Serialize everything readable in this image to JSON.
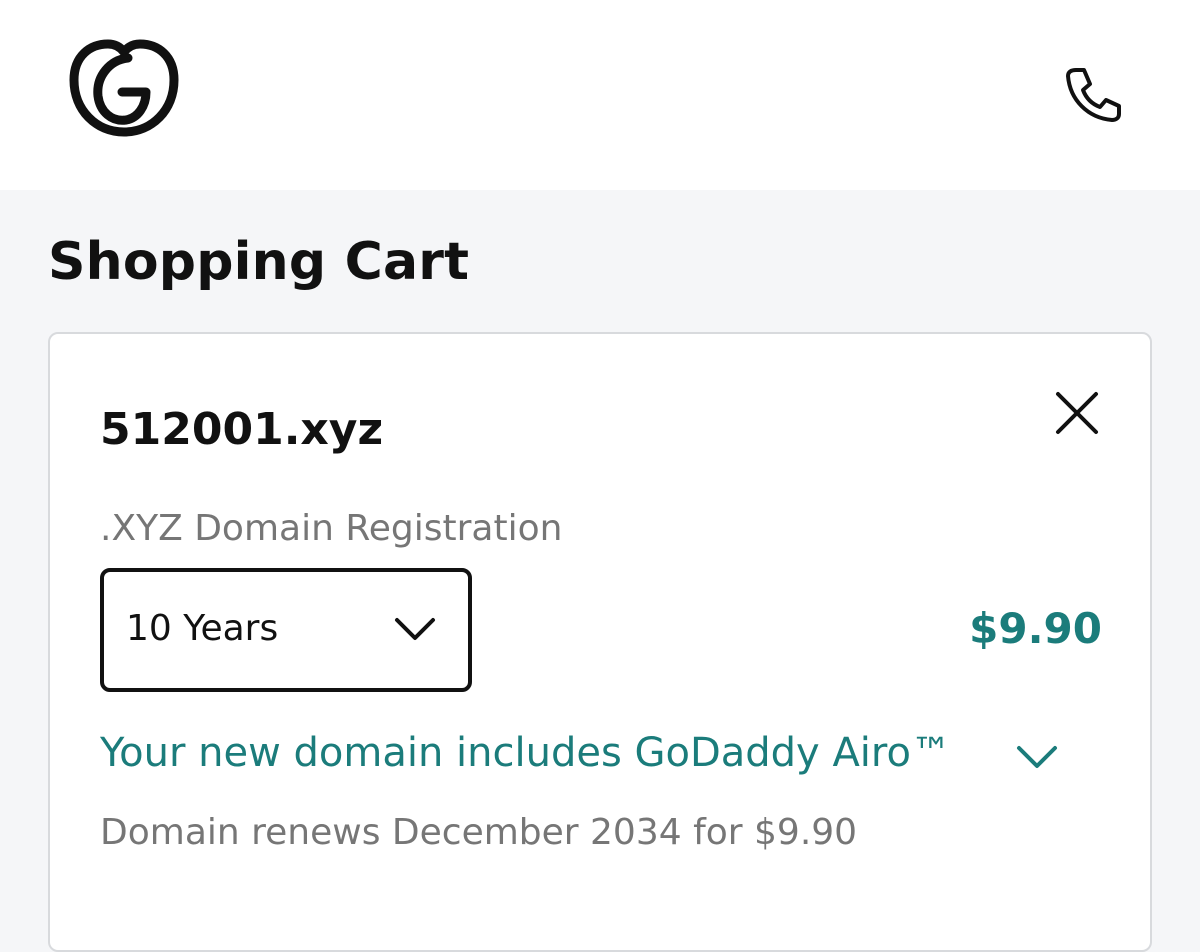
{
  "header": {
    "logo_icon": "godaddy-logo-icon",
    "phone_icon": "phone-icon"
  },
  "page": {
    "title": "Shopping Cart"
  },
  "cart_item": {
    "domain": "512001.xyz",
    "product": ".XYZ Domain Registration",
    "term_selected": "10 Years",
    "price": "$9.90",
    "airo_text": "Your new domain includes GoDaddy Airo™",
    "renewal_text": "Domain renews December 2034 for $9.90",
    "close_icon": "close-icon",
    "chevron_icon": "chevron-down-icon"
  },
  "colors": {
    "accent": "#1b7c7b",
    "text": "#111111",
    "muted": "#767676",
    "page_bg": "#f5f6f8",
    "card_border": "#d8dadd"
  }
}
